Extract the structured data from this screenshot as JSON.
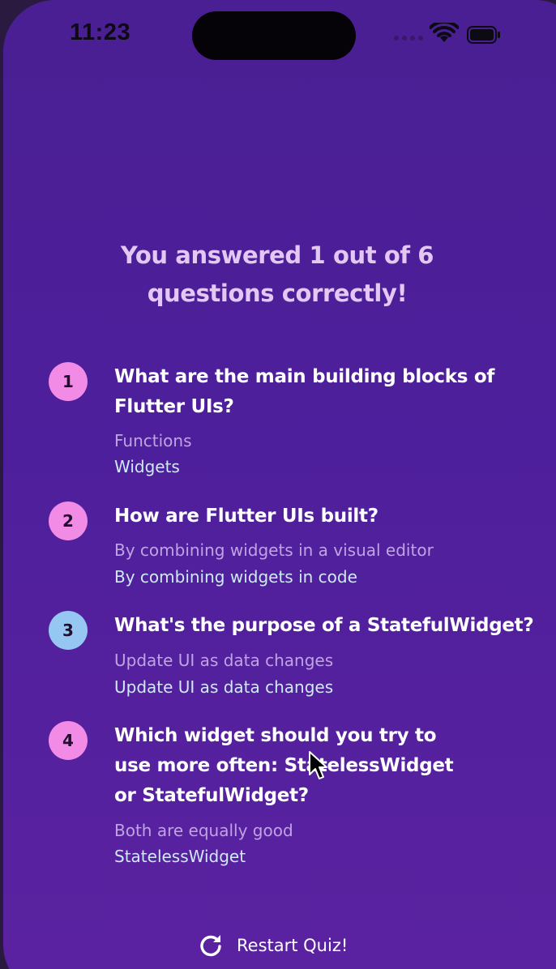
{
  "status_bar": {
    "time": "11:23",
    "icons": [
      "signal-icon",
      "wifi-icon",
      "battery-icon"
    ]
  },
  "summary": {
    "headline": "You answered 1 out of 6 questions correctly!"
  },
  "questions": [
    {
      "index": "1",
      "question": "What are the main building blocks of Flutter UIs?",
      "user_answer": "Functions",
      "correct_answer": "Widgets",
      "is_correct": false
    },
    {
      "index": "2",
      "question": "How are Flutter UIs built?",
      "user_answer": "By combining widgets in a visual editor",
      "correct_answer": "By combining widgets in code",
      "is_correct": false
    },
    {
      "index": "3",
      "question": "What's the purpose of a StatefulWidget?",
      "user_answer": "Update UI as data changes",
      "correct_answer": "Update UI as data changes",
      "is_correct": true
    },
    {
      "index": "4",
      "question": "Which widget should you try to use more often: StatelessWidget or StatefulWidget?",
      "user_answer": "Both are equally good",
      "correct_answer": "StatelessWidget",
      "is_correct": false
    }
  ],
  "restart_button": {
    "label": "Restart Quiz!",
    "icon": "refresh-icon"
  },
  "colors": {
    "background_top": "#4a1f93",
    "background_bottom": "#5b22a0",
    "badge_incorrect": "#f28be6",
    "badge_correct": "#96c6f2",
    "headline_text": "#e3c8f3",
    "user_answer_text": "#c0a3e3",
    "correct_answer_text": "#cfeaf6"
  }
}
